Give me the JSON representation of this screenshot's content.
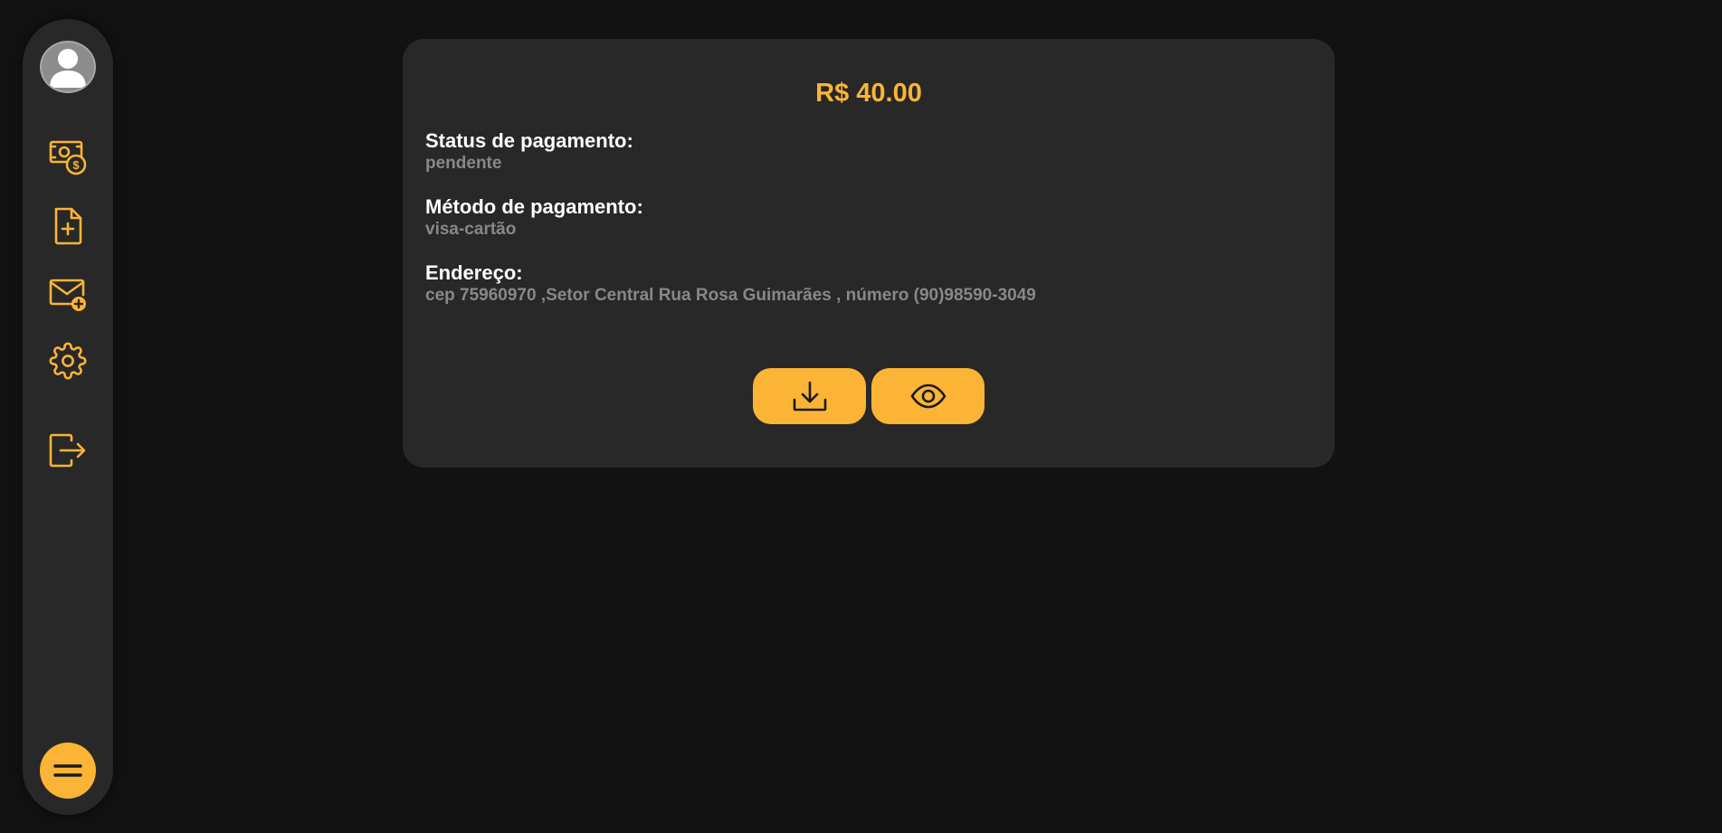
{
  "sidebar": {
    "icons": {
      "avatar": "user-avatar",
      "payments": "money-coin-icon",
      "new_document": "file-plus-icon",
      "new_message": "mail-plus-icon",
      "settings": "gear-icon",
      "logout": "logout-icon",
      "menu": "hamburger-icon"
    }
  },
  "payment": {
    "amount": "R$ 40.00",
    "status_label": "Status de pagamento:",
    "status_value": "pendente",
    "method_label": "Método de pagamento:",
    "method_value": "visa-cartão",
    "address_label": "Endereço:",
    "address_value": "cep 75960970 ,Setor Central Rua Rosa Guimarães , número (90)98590-3049"
  },
  "actions": {
    "download_icon": "download-icon",
    "view_icon": "eye-icon"
  },
  "colors": {
    "background": "#121212",
    "panel": "#282828",
    "accent": "#fbb436",
    "label": "#ffffff",
    "muted": "#888888"
  }
}
